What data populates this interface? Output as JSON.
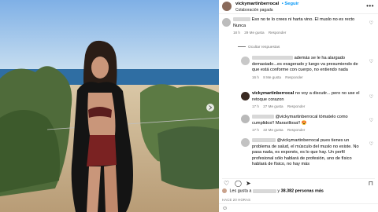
{
  "header": {
    "username": "vickymartinberrocal",
    "follow_label": "• Seguir",
    "subtitle": "Colaboración pagada",
    "more_icon": "more-dots-icon"
  },
  "comments": [
    {
      "username_hidden": true,
      "text": "Eso no te lo crees ni harta vino. El muslo no es recto Nunca",
      "meta": {
        "time": "18 h",
        "likes": "29 Me gusta",
        "reply": "Responder"
      }
    }
  ],
  "hide_replies": "Ocultar respuestas",
  "replies": [
    {
      "username_hidden": true,
      "text": "además se le ha alargado demasiado...es exagerado y luego va presumiendo de que está conforme con cuerpo, no entiendo nada",
      "meta": {
        "time": "16 h",
        "likes": "8 Me gusta",
        "reply": "Responder"
      }
    },
    {
      "username": "vickymartinberrocal",
      "text": "no voy a discutir... pero no use el retoque corazon",
      "meta": {
        "time": "17 h",
        "likes": "27 Me gusta",
        "reply": "Responder"
      }
    },
    {
      "username_hidden": true,
      "mention": "@vickymartinberrocal",
      "text": "tómatelo como cumplidos!! Maravillosa!!",
      "emoji": "😍",
      "meta": {
        "time": "17 h",
        "likes": "22 Me gusta",
        "reply": "Responder"
      }
    },
    {
      "username_hidden": true,
      "mention": "@vickymartinberrocal",
      "text": "pues tienes un problema de salud, el músculo del muslo no existe. No pasa nada, es exponés, es lo que hay. Un perfil profesional sólo hablará de profesión, uno de físico hablará de físico, no hay más",
      "meta": {
        "time": "",
        "likes": "",
        "reply": ""
      }
    }
  ],
  "actions": {
    "like_icon": "heart-icon",
    "comment_icon": "comment-icon",
    "share_icon": "share-icon",
    "save_icon": "bookmark-icon"
  },
  "likes_text": {
    "prefix": "Les gusta a",
    "connector": "y",
    "count": "38.382 personas más"
  },
  "date": "HACE 20 HORAS",
  "add_comment": {
    "emoji_icon": "smiley-icon"
  },
  "colors": {
    "follow": "#0095f6",
    "meta": "#737373",
    "sky": "#8fb8e0",
    "sea": "#2f6ea3"
  }
}
